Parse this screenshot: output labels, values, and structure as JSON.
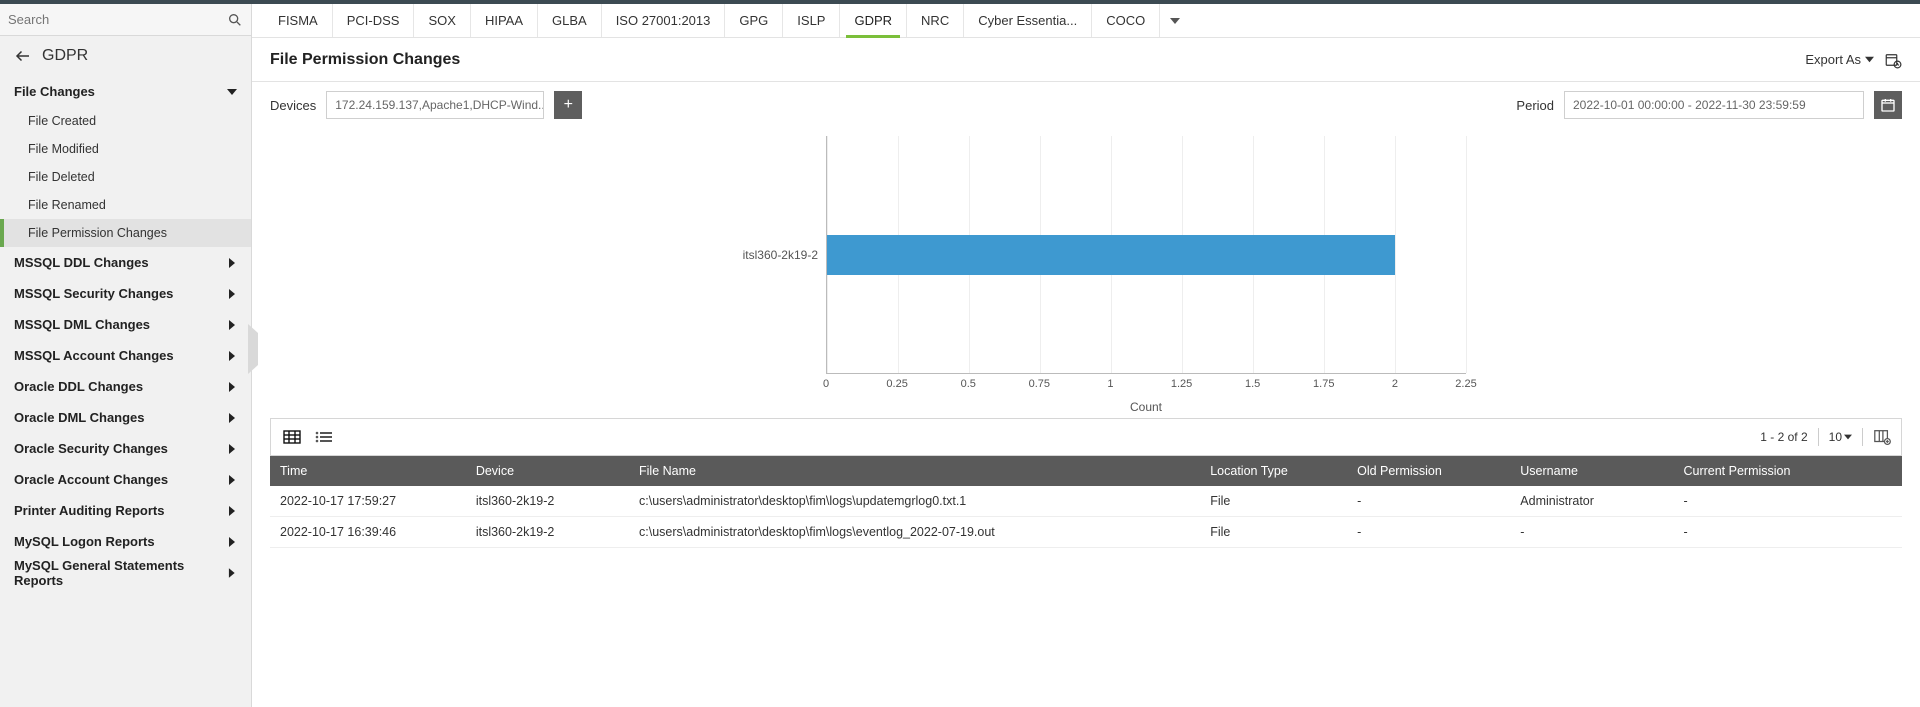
{
  "search": {
    "placeholder": "Search"
  },
  "breadcrumb": "GDPR",
  "sidebar": {
    "section": "File Changes",
    "subs": [
      {
        "label": "File Created"
      },
      {
        "label": "File Modified"
      },
      {
        "label": "File Deleted"
      },
      {
        "label": "File Renamed"
      },
      {
        "label": "File Permission Changes"
      }
    ],
    "groups": [
      "MSSQL DDL Changes",
      "MSSQL Security Changes",
      "MSSQL DML Changes",
      "MSSQL Account Changes",
      "Oracle DDL Changes",
      "Oracle DML Changes",
      "Oracle Security Changes",
      "Oracle Account Changes",
      "Printer Auditing Reports",
      "MySQL Logon Reports",
      "MySQL General Statements Reports"
    ]
  },
  "tabs": [
    "FISMA",
    "PCI-DSS",
    "SOX",
    "HIPAA",
    "GLBA",
    "ISO 27001:2013",
    "GPG",
    "ISLP",
    "GDPR",
    "NRC",
    "Cyber Essentia...",
    "COCO"
  ],
  "tabs_active_index": 8,
  "page_title": "File Permission Changes",
  "export_label": "Export As",
  "filters": {
    "devices_label": "Devices",
    "devices_value": "172.24.159.137,Apache1,DHCP-Wind...",
    "period_label": "Period",
    "period_value": "2022-10-01 00:00:00 - 2022-11-30 23:59:59"
  },
  "chart_data": {
    "type": "bar",
    "orientation": "horizontal",
    "categories": [
      "itsl360-2k19-2"
    ],
    "values": [
      2
    ],
    "xlabel": "Count",
    "ylabel": "",
    "xlim": [
      0,
      2.25
    ],
    "ticks": [
      0,
      0.25,
      0.5,
      0.75,
      1,
      1.25,
      1.5,
      1.75,
      2,
      2.25
    ]
  },
  "table": {
    "count_text": "1 - 2 of 2",
    "page_size": "10",
    "headers": [
      "Time",
      "Device",
      "File Name",
      "Location Type",
      "Old Permission",
      "Username",
      "Current Permission"
    ],
    "rows": [
      {
        "time": "2022-10-17 17:59:27",
        "device": "itsl360-2k19-2",
        "file": "c:\\users\\administrator\\desktop\\fim\\logs\\updatemgrlog0.txt.1",
        "loc": "File",
        "oldp": "-",
        "user": "Administrator",
        "curp": "-"
      },
      {
        "time": "2022-10-17 16:39:46",
        "device": "itsl360-2k19-2",
        "file": "c:\\users\\administrator\\desktop\\fim\\logs\\eventlog_2022-07-19.out",
        "loc": "File",
        "oldp": "-",
        "user": "-",
        "curp": "-"
      }
    ]
  }
}
